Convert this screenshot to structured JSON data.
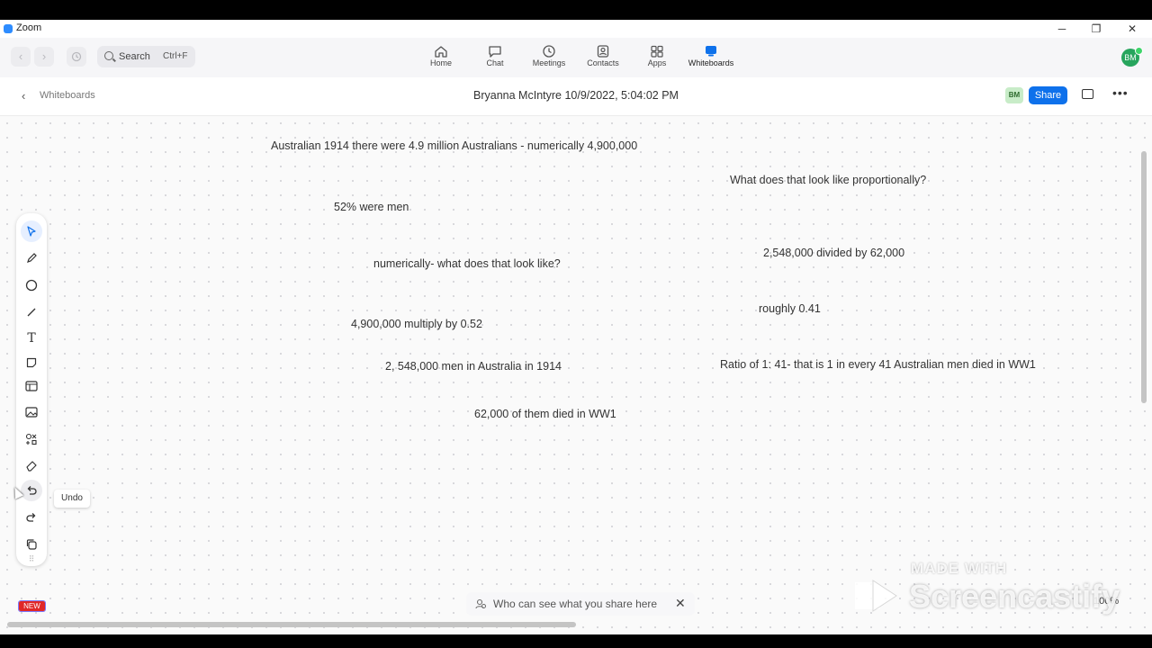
{
  "app": {
    "title": "Zoom"
  },
  "window_controls": {
    "minimize": "─",
    "restore": "❐",
    "close": "✕"
  },
  "nav": {
    "back": "‹",
    "forward": "›"
  },
  "search": {
    "label": "Search",
    "shortcut": "Ctrl+F"
  },
  "tabs": [
    {
      "label": "Home",
      "icon": "home-icon"
    },
    {
      "label": "Chat",
      "icon": "chat-icon"
    },
    {
      "label": "Meetings",
      "icon": "clock-icon"
    },
    {
      "label": "Contacts",
      "icon": "contacts-icon"
    },
    {
      "label": "Apps",
      "icon": "apps-icon"
    },
    {
      "label": "Whiteboards",
      "icon": "whiteboard-icon",
      "active": true
    }
  ],
  "user": {
    "initials": "BM",
    "status_color": "#3ed46a"
  },
  "subheader": {
    "back_label": "Whiteboards",
    "doc_title": "Bryanna McIntyre 10/9/2022, 5:04:02 PM",
    "collab_initials": "BM",
    "share_label": "Share"
  },
  "canvas": {
    "notes": [
      "Australian 1914 there were 4.9 million Australians - numerically 4,900,000",
      "What does that look like proportionally?",
      "52% were men",
      "2,548,000 divided by 62,000",
      "numerically- what does that look like?",
      "roughly 0.41",
      "4,900,000 multiply by 0.52",
      "2, 548,000 men in Australia in 1914",
      "Ratio of 1: 41- that is 1 in every 41 Australian men died in WW1",
      "62,000 of them died in WW1"
    ]
  },
  "toolbar": {
    "tools": [
      "select-tool",
      "pen-tool",
      "circle-tool",
      "line-tool",
      "text-tool",
      "sticky-note-tool",
      "template-tool",
      "image-tool",
      "shapes-tool",
      "eraser-tool",
      "undo-tool",
      "redo-tool",
      "copy-tool",
      "more-tool"
    ],
    "tooltip": "Undo"
  },
  "badges": {
    "new": "NEW"
  },
  "share_notice": {
    "text": "Who can see what you share here"
  },
  "zoom": {
    "value": "100%"
  },
  "watermark": {
    "made_with": "MADE WITH",
    "brand": "Screencastify"
  },
  "colors": {
    "accent": "#0e71eb",
    "avatar": "#27a55d"
  }
}
